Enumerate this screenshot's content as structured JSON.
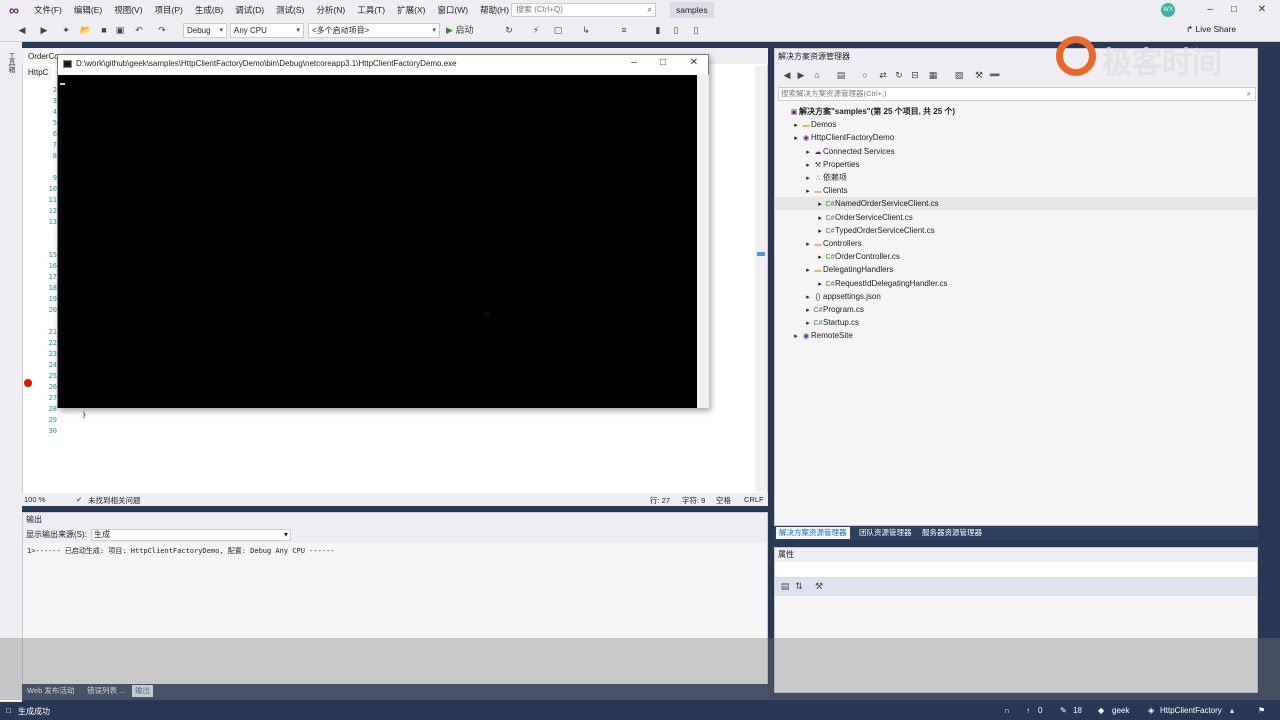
{
  "menu": {
    "items": [
      "文件(F)",
      "编辑(E)",
      "视图(V)",
      "项目(P)",
      "生成(B)",
      "调试(D)",
      "测试(S)",
      "分析(N)",
      "工具(T)",
      "扩展(X)",
      "窗口(W)",
      "帮助(H)"
    ],
    "search_placeholder": "搜索 (Ctrl+Q)",
    "solution_name": "samples",
    "avatar_initials": "WX"
  },
  "toolbar": {
    "config": "Debug",
    "platform": "Any CPU",
    "startup": "<多个启动项目>",
    "start_label": "启动",
    "live_share": "Live Share"
  },
  "left_strip": {
    "label": "工具箱"
  },
  "editor": {
    "tabs": [
      "OrderCo",
      "HttpC"
    ],
    "line_numbers": [
      "2",
      "3",
      "4",
      "5",
      "6",
      "7",
      "8",
      "9",
      "10",
      "11",
      "12",
      "13",
      "15",
      "16",
      "17",
      "18",
      "19",
      "20",
      "21",
      "22",
      "23",
      "24",
      "25",
      "26",
      "27",
      "28",
      "29",
      "30"
    ],
    "code_line_29": "}",
    "zoom": "100 %",
    "issues": "未找到相关问题",
    "line": "行: 27",
    "char": "字符: 9",
    "spaces": "空格",
    "eol": "CRLF"
  },
  "console": {
    "title": "D:\\work\\github\\geek\\samples\\HttpClientFactoryDemo\\bin\\Debug\\netcoreapp3.1\\HttpClientFactoryDemo.exe"
  },
  "solution_explorer": {
    "header": "解决方案资源管理器",
    "search_placeholder": "搜索解决方案资源管理器(Ctrl+;)",
    "tree": [
      {
        "label": "解决方案\"samples\"(第 25 个项目, 共 25 个)",
        "indent": 0,
        "bold": true
      },
      {
        "label": "Demos",
        "indent": 1
      },
      {
        "label": "HttpClientFactoryDemo",
        "indent": 1
      },
      {
        "label": "Connected Services",
        "indent": 2
      },
      {
        "label": "Properties",
        "indent": 2
      },
      {
        "label": "依赖项",
        "indent": 2
      },
      {
        "label": "Clients",
        "indent": 2
      },
      {
        "label": "NamedOrderServiceClient.cs",
        "indent": 3,
        "selected": true
      },
      {
        "label": "OrderServiceClient.cs",
        "indent": 3
      },
      {
        "label": "TypedOrderServiceClient.cs",
        "indent": 3
      },
      {
        "label": "Controllers",
        "indent": 2
      },
      {
        "label": "OrderController.cs",
        "indent": 3
      },
      {
        "label": "DelegatingHandlers",
        "indent": 2
      },
      {
        "label": "RequestIdDelegatingHandler.cs",
        "indent": 3
      },
      {
        "label": "appsettings.json",
        "indent": 2
      },
      {
        "label": "Program.cs",
        "indent": 2
      },
      {
        "label": "Startup.cs",
        "indent": 2
      },
      {
        "label": "RemoteSite",
        "indent": 1
      }
    ],
    "tabs": [
      "解决方案资源管理器",
      "团队资源管理器",
      "服务器资源管理器"
    ]
  },
  "properties": {
    "header": "属性"
  },
  "output": {
    "header": "输出",
    "source_label": "显示输出来源(S):",
    "source_value": "生成",
    "text": "1>------ 已启动生成: 项目: HttpClientFactoryDemo, 配置: Debug Any CPU ------",
    "tabs": [
      "Web 发布活动",
      "错误列表 ...",
      "输出"
    ]
  },
  "status": {
    "message": "生成成功",
    "up_count": "0",
    "edit_count": "18",
    "branch_user": "geek",
    "project": "HttpClientFactory"
  },
  "watermark": {
    "text": "极客时间"
  }
}
